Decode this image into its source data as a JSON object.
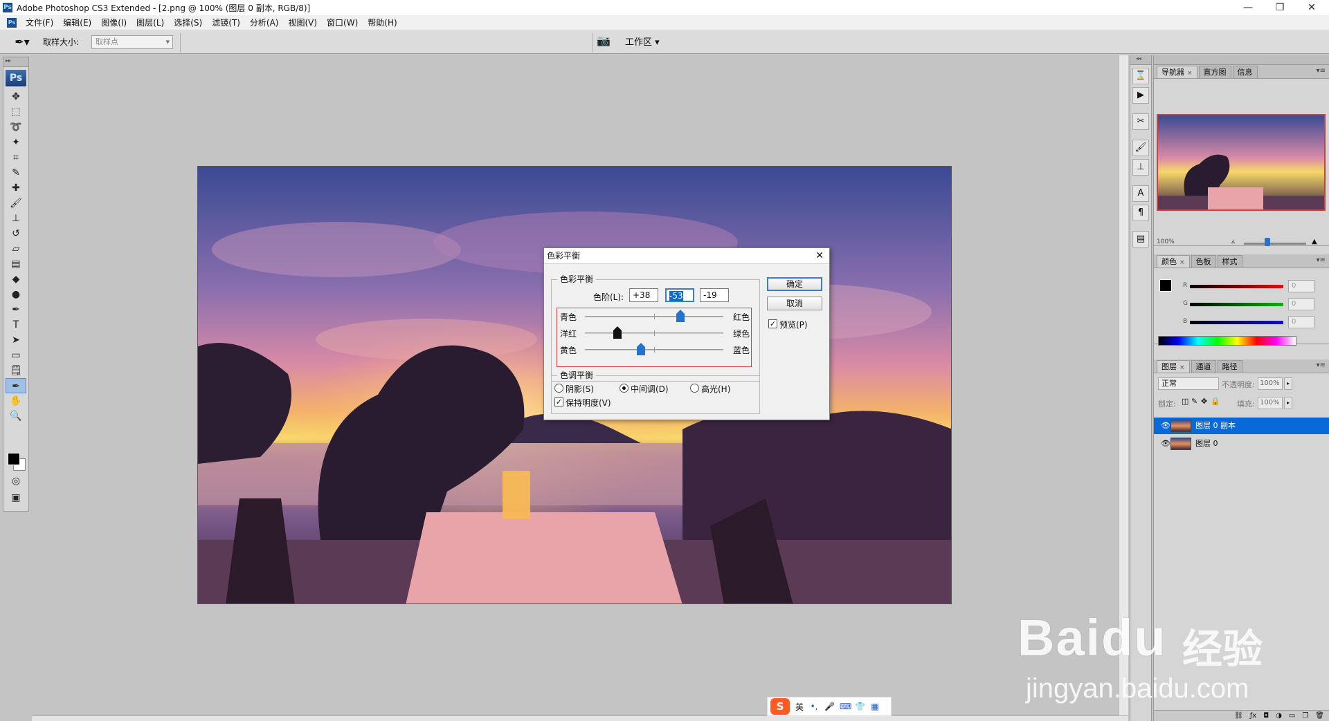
{
  "window": {
    "app_icon": "Ps",
    "title": "Adobe Photoshop CS3 Extended - [2.png @ 100% (图层 0 副本, RGB/8)]"
  },
  "menu": {
    "items": [
      "文件(F)",
      "编辑(E)",
      "图像(I)",
      "图层(L)",
      "选择(S)",
      "滤镜(T)",
      "分析(A)",
      "视图(V)",
      "窗口(W)",
      "帮助(H)"
    ]
  },
  "options_bar": {
    "sample_size_label": "取样大小:",
    "sample_size_value": "取样点",
    "workspace_label": "工作区 ▾"
  },
  "toolbox": {
    "logo": "Ps"
  },
  "panels": {
    "navigator_tabs": [
      "导航器",
      "直方图",
      "信息"
    ],
    "navigator_zoom": "100%",
    "color_tabs": [
      "颜色",
      "色板",
      "样式"
    ],
    "color_rows": [
      {
        "label": "R",
        "value": "0",
        "color": "#e01010"
      },
      {
        "label": "G",
        "value": "0",
        "color": "#10b010"
      },
      {
        "label": "B",
        "value": "0",
        "color": "#1010d0"
      }
    ],
    "layers_tabs": [
      "图层",
      "通道",
      "路径"
    ],
    "blend_mode": "正常",
    "opacity_label": "不透明度:",
    "opacity_value": "100%",
    "lock_label": "锁定:",
    "fill_label": "填充:",
    "fill_value": "100%",
    "layers": [
      {
        "name": "图层 0 副本",
        "selected": true
      },
      {
        "name": "图层 0",
        "selected": false
      }
    ]
  },
  "dialog": {
    "title": "色彩平衡",
    "color_balance_legend": "色彩平衡",
    "levels_label": "色阶(L):",
    "levels": [
      "+38",
      "-53",
      "-19"
    ],
    "sliders": [
      {
        "left": "青色",
        "right": "红色",
        "value": 38,
        "accent": "#1f74d0"
      },
      {
        "left": "洋红",
        "right": "绿色",
        "value": -53,
        "accent": "#111111"
      },
      {
        "left": "黄色",
        "right": "蓝色",
        "value": -19,
        "accent": "#1f74d0"
      }
    ],
    "tone_legend": "色调平衡",
    "tones": [
      "阴影(S)",
      "中间调(D)",
      "高光(H)"
    ],
    "tone_selected": "中间调(D)",
    "preserve_luminosity": "保持明度(V)",
    "ok_label": "确定",
    "cancel_label": "取消",
    "preview_label": "预览(P)"
  },
  "ime": {
    "logo": "S",
    "lang": "英"
  },
  "watermark": {
    "brand": "Bai",
    "brand2": "du",
    "cn": "经验",
    "url": "jingyan.baidu.com"
  }
}
